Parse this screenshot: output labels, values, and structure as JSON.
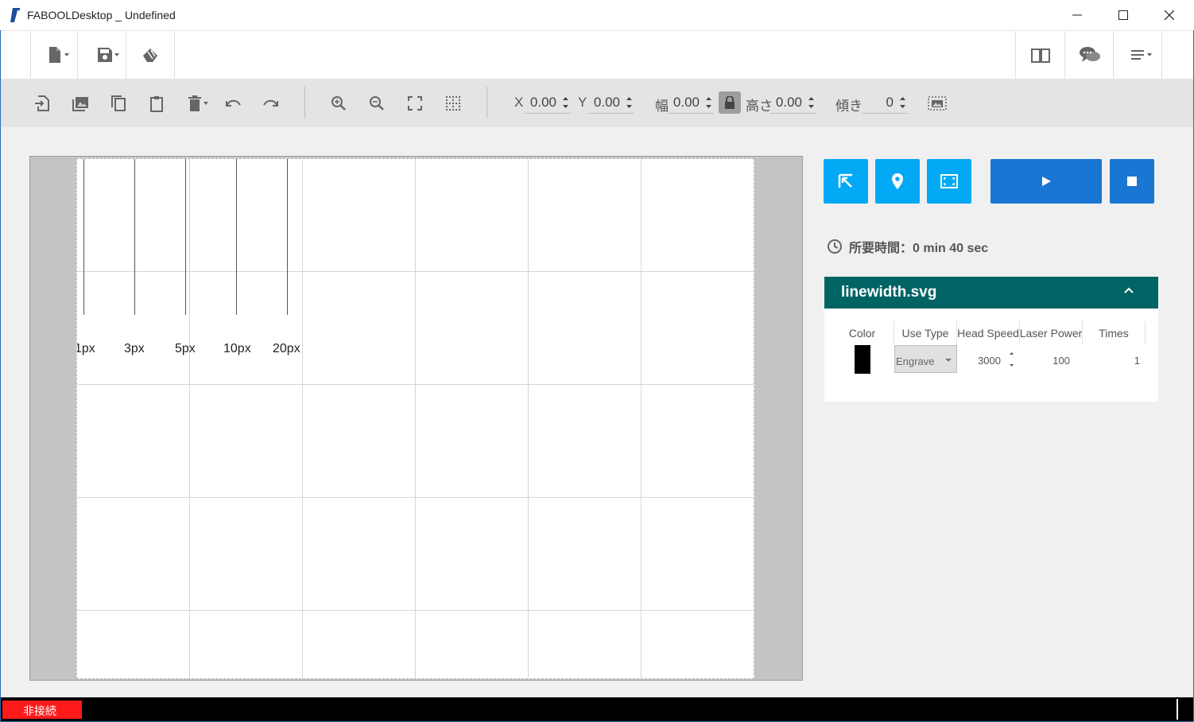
{
  "window": {
    "title": "FABOOLDesktop _ Undefined",
    "controls": [
      "minimize",
      "maximize",
      "close"
    ]
  },
  "toolbar_main": {
    "left": [
      {
        "name": "new-file",
        "icon": "file-icon",
        "dropdown": true
      },
      {
        "name": "save-file",
        "icon": "floppy-icon",
        "dropdown": true
      },
      {
        "name": "material",
        "icon": "material-icon",
        "dropdown": false
      }
    ],
    "right": [
      {
        "name": "manual",
        "icon": "book-icon"
      },
      {
        "name": "support",
        "icon": "chat-icon"
      },
      {
        "name": "menu",
        "icon": "menu-icon",
        "dropdown": true
      }
    ]
  },
  "toolbar_edit": {
    "coords": {
      "x_label": "X",
      "x_value": "0.00",
      "y_label": "Y",
      "y_value": "0.00",
      "w_label": "幅",
      "w_value": "0.00",
      "h_label": "高さ",
      "h_value": "0.00",
      "tilt_label": "傾き",
      "tilt_value": "0"
    }
  },
  "canvas": {
    "stroke_labels": [
      "1px",
      "3px",
      "5px",
      "10px",
      "20px"
    ]
  },
  "controls": {
    "time_label": "所要時間：0 min 40 sec"
  },
  "file_panel": {
    "file_name": "linewidth.svg",
    "columns": [
      "Color",
      "Use Type",
      "Head Speed",
      "Laser Power",
      "Times"
    ],
    "row": {
      "color": "#000000",
      "use_type": "Engrave",
      "head_speed": "3000",
      "laser_power": "100",
      "times": "1"
    }
  },
  "status": {
    "connection": "非接続",
    "color": "#ff1a1a"
  },
  "colors": {
    "accent_cyan": "#03a9f4",
    "accent_blue": "#1976d2",
    "file_header": "#006464"
  }
}
